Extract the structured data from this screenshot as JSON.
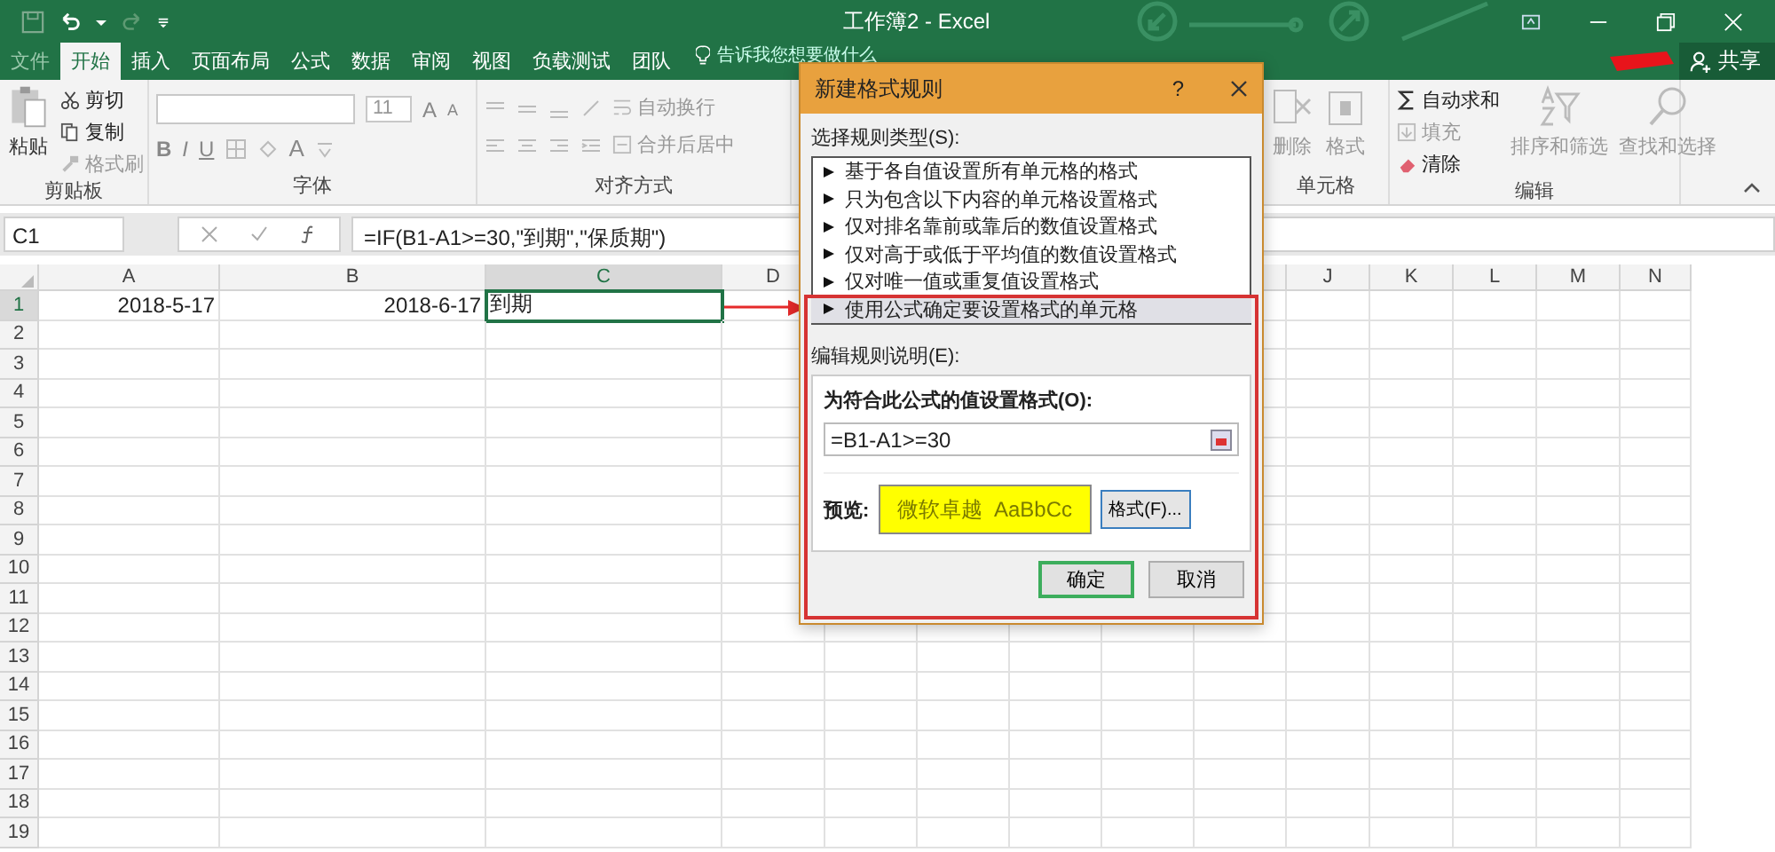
{
  "window": {
    "title": "工作簿2 - Excel"
  },
  "share": {
    "label": "共享"
  },
  "tabs": [
    {
      "label": "文件",
      "selected": false
    },
    {
      "label": "开始",
      "selected": true
    },
    {
      "label": "插入",
      "selected": false
    },
    {
      "label": "页面布局",
      "selected": false
    },
    {
      "label": "公式",
      "selected": false
    },
    {
      "label": "数据",
      "selected": false
    },
    {
      "label": "审阅",
      "selected": false
    },
    {
      "label": "视图",
      "selected": false
    },
    {
      "label": "负载测试",
      "selected": false
    },
    {
      "label": "团队",
      "selected": false
    }
  ],
  "tell_me": {
    "placeholder": "告诉我您想要做什么"
  },
  "ribbon": {
    "clipboard": {
      "paste": "粘贴",
      "cut": "剪切",
      "copy": "复制",
      "format_painter": "格式刷",
      "label": "剪贴板"
    },
    "font": {
      "font_size": "11",
      "grow": "A",
      "shrink": "A",
      "bold": "B",
      "italic": "I",
      "underline": "U",
      "font_color": "A",
      "label": "字体"
    },
    "alignment": {
      "wrap_text": "自动换行",
      "merge_center": "合并后居中",
      "label": "对齐方式"
    },
    "cells": {
      "delete": "删除",
      "format": "格式",
      "label": "单元格"
    },
    "editing": {
      "autosum": "自动求和",
      "fill": "填充",
      "clear": "清除",
      "sort_filter": "排序和筛选",
      "find_select": "查找和选择",
      "label": "编辑"
    }
  },
  "formula_bar": {
    "name_box": "C1",
    "formula": "=IF(B1-A1>=30,\"到期\",\"保质期\")"
  },
  "sheet": {
    "columns_left": [
      "A",
      "B",
      "C",
      "D"
    ],
    "columns_right": [
      "J",
      "K",
      "L",
      "M",
      "N"
    ],
    "rows": [
      "1",
      "2",
      "3",
      "4",
      "5",
      "6",
      "7",
      "8",
      "9",
      "10",
      "11",
      "12",
      "13",
      "14",
      "15",
      "16",
      "17",
      "18",
      "19"
    ],
    "row_1": [
      {
        "text": "2018-5-17",
        "selected": false
      },
      {
        "text": "2018-6-17",
        "selected": false
      },
      {
        "text": "到期",
        "selected": true
      }
    ]
  },
  "dialog": {
    "title": "新建格式规则",
    "help": "?",
    "rule_type_label": "选择规则类型(S):",
    "rule_types": [
      {
        "label": "基于各自值设置所有单元格的格式",
        "selected": false
      },
      {
        "label": "只为包含以下内容的单元格设置格式",
        "selected": false
      },
      {
        "label": "仅对排名靠前或靠后的数值设置格式",
        "selected": false
      },
      {
        "label": "仅对高于或低于平均值的数值设置格式",
        "selected": false
      },
      {
        "label": "仅对唯一值或重复值设置格式",
        "selected": false
      },
      {
        "label": "使用公式确定要设置格式的单元格",
        "selected": true
      }
    ],
    "description_label": "编辑规则说明(E):",
    "formula_label": "为符合此公式的值设置格式(O):",
    "formula": "=B1-A1>=30",
    "preview_label": "预览:",
    "preview_text": "微软卓越  AaBbCc",
    "format_button": "格式(F)...",
    "ok": "确定",
    "cancel": "取消"
  }
}
